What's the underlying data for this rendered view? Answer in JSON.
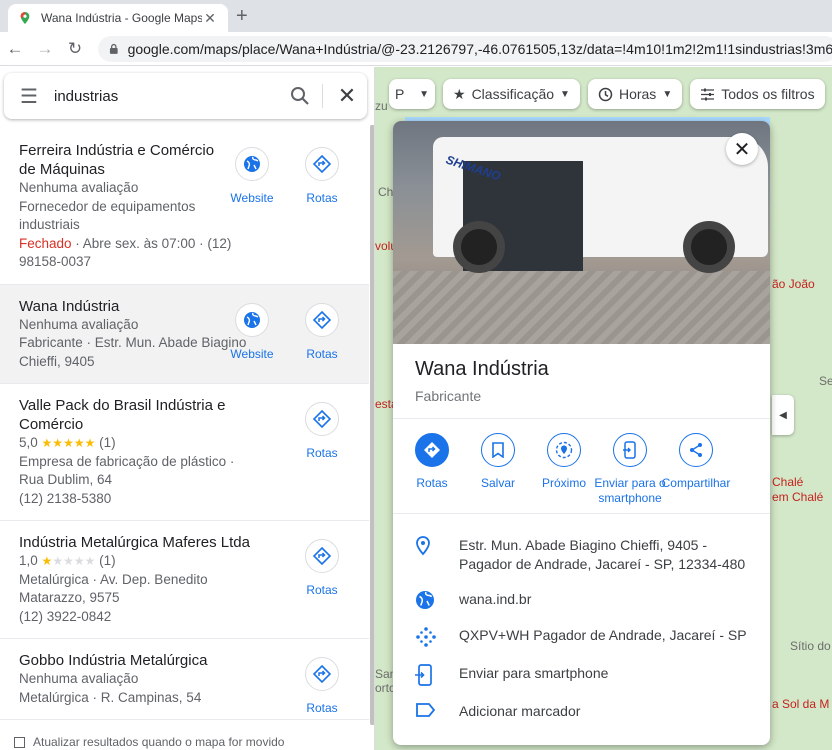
{
  "browser": {
    "tab_title": "Wana Indústria - Google Maps",
    "tab_close": "✕",
    "new_tab": "+",
    "url": "google.com/maps/place/Wana+Indústria/@-23.2126797,-46.0761505,13z/data=!4m10!1m2!2m1!1sindustrias!3m6!1s..."
  },
  "search": {
    "query": "industrias"
  },
  "results": [
    {
      "title": "Ferreira Indústria e Comércio de Máquinas",
      "lines": [
        "Nenhuma avaliação",
        "Fornecedor de equipamentos industriais"
      ],
      "status_closed": "Fechado",
      "status_rest": " · Abre sex. às 07:00 · (12) 98158-0037",
      "website_label": "Website",
      "route_label": "Rotas"
    },
    {
      "title": "Wana Indústria",
      "lines": [
        "Nenhuma avaliação",
        "Fabricante · Estr. Mun. Abade Biagino Chieffi, 9405"
      ],
      "website_label": "Website",
      "route_label": "Rotas"
    },
    {
      "title": "Valle Pack do Brasil Indústria e Comércio",
      "rating": "5,0",
      "rating_count": "(1)",
      "lines": [
        "Empresa de fabricação de plástico · Rua Dublim, 64",
        "(12) 2138-5380"
      ],
      "route_label": "Rotas"
    },
    {
      "title": "Indústria Metalúrgica Maferes Ltda",
      "rating": "1,0",
      "rating_count": "(1)",
      "lines": [
        "Metalúrgica · Av. Dep. Benedito Matarazzo, 9575",
        "(12) 3922-0842"
      ],
      "route_label": "Rotas"
    },
    {
      "title": "Gobbo Indústria Metalúrgica",
      "lines": [
        "Nenhuma avaliação",
        "Metalúrgica · R. Campinas, 54"
      ],
      "route_label": "Rotas"
    }
  ],
  "footer": {
    "update_checkbox_label": "Atualizar resultados quando o mapa for movido"
  },
  "map": {
    "filters": {
      "sort": "Classificação",
      "hours": "Horas",
      "all": "Todos os filtros"
    },
    "labels": [
      "zu",
      "Ch",
      "volu",
      "esta",
      "ão João",
      "Se",
      "Chalé",
      "em Chalé",
      "Sítio do",
      "Sant",
      "orto",
      "a Sol da M"
    ]
  },
  "place": {
    "name": "Wana Indústria",
    "category": "Fabricante",
    "actions": [
      "Rotas",
      "Salvar",
      "Próximo",
      "Enviar para o smartphone",
      "Compartilhar"
    ],
    "address": "Estr. Mun. Abade Biagino Chieffi, 9405 - Pagador de Andrade, Jacareí - SP, 12334-480",
    "website": "wana.ind.br",
    "plus_code": "QXPV+WH Pagador de Andrade, Jacareí - SP",
    "send_to_phone": "Enviar para smartphone",
    "add_label": "Adicionar marcador",
    "photo_text": "SHIMANO"
  },
  "colors": {
    "accent": "#1a73e8",
    "closed": "#d93025",
    "star": "#fbbc04"
  }
}
